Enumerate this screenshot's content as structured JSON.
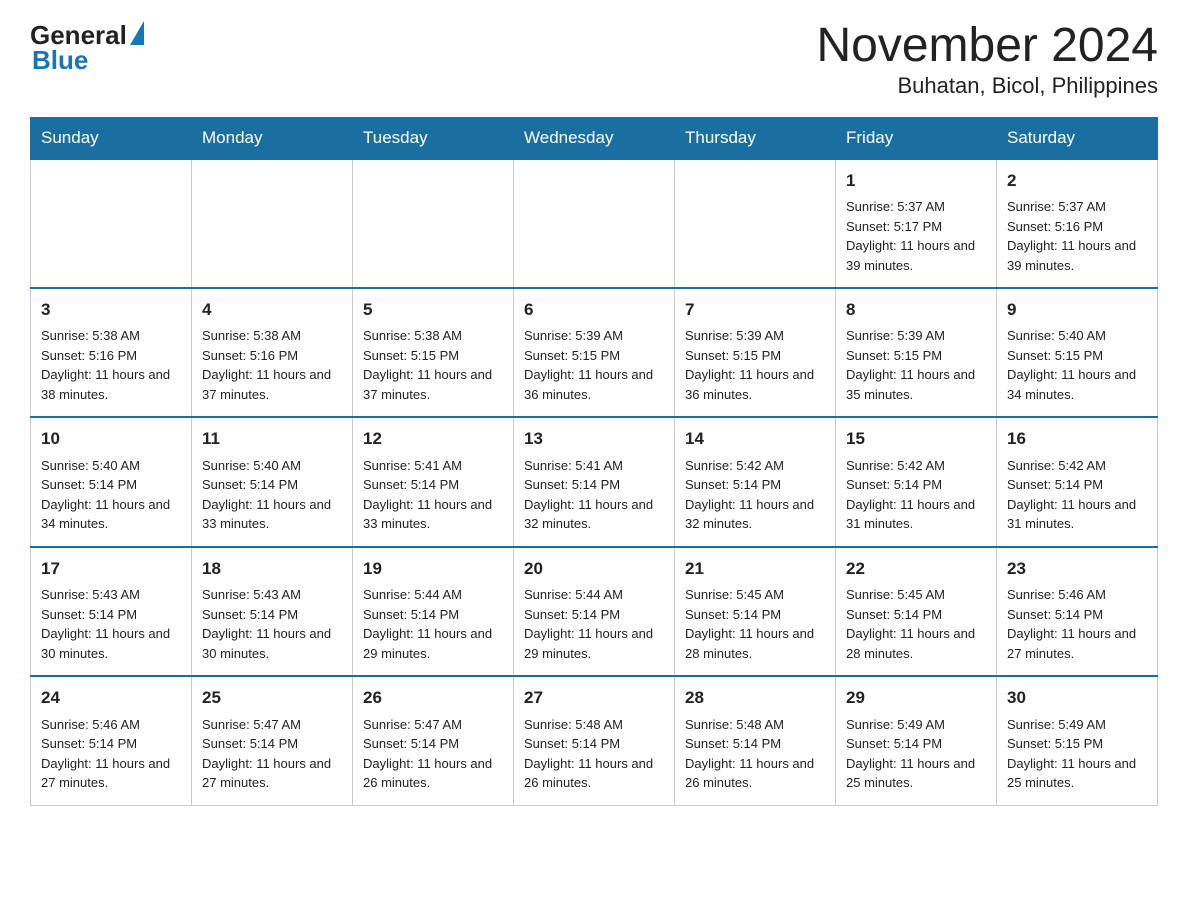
{
  "header": {
    "logo_general": "General",
    "logo_blue": "Blue",
    "title": "November 2024",
    "subtitle": "Buhatan, Bicol, Philippines"
  },
  "days_of_week": [
    "Sunday",
    "Monday",
    "Tuesday",
    "Wednesday",
    "Thursday",
    "Friday",
    "Saturday"
  ],
  "weeks": [
    [
      {
        "day": "",
        "info": ""
      },
      {
        "day": "",
        "info": ""
      },
      {
        "day": "",
        "info": ""
      },
      {
        "day": "",
        "info": ""
      },
      {
        "day": "",
        "info": ""
      },
      {
        "day": "1",
        "info": "Sunrise: 5:37 AM\nSunset: 5:17 PM\nDaylight: 11 hours and 39 minutes."
      },
      {
        "day": "2",
        "info": "Sunrise: 5:37 AM\nSunset: 5:16 PM\nDaylight: 11 hours and 39 minutes."
      }
    ],
    [
      {
        "day": "3",
        "info": "Sunrise: 5:38 AM\nSunset: 5:16 PM\nDaylight: 11 hours and 38 minutes."
      },
      {
        "day": "4",
        "info": "Sunrise: 5:38 AM\nSunset: 5:16 PM\nDaylight: 11 hours and 37 minutes."
      },
      {
        "day": "5",
        "info": "Sunrise: 5:38 AM\nSunset: 5:15 PM\nDaylight: 11 hours and 37 minutes."
      },
      {
        "day": "6",
        "info": "Sunrise: 5:39 AM\nSunset: 5:15 PM\nDaylight: 11 hours and 36 minutes."
      },
      {
        "day": "7",
        "info": "Sunrise: 5:39 AM\nSunset: 5:15 PM\nDaylight: 11 hours and 36 minutes."
      },
      {
        "day": "8",
        "info": "Sunrise: 5:39 AM\nSunset: 5:15 PM\nDaylight: 11 hours and 35 minutes."
      },
      {
        "day": "9",
        "info": "Sunrise: 5:40 AM\nSunset: 5:15 PM\nDaylight: 11 hours and 34 minutes."
      }
    ],
    [
      {
        "day": "10",
        "info": "Sunrise: 5:40 AM\nSunset: 5:14 PM\nDaylight: 11 hours and 34 minutes."
      },
      {
        "day": "11",
        "info": "Sunrise: 5:40 AM\nSunset: 5:14 PM\nDaylight: 11 hours and 33 minutes."
      },
      {
        "day": "12",
        "info": "Sunrise: 5:41 AM\nSunset: 5:14 PM\nDaylight: 11 hours and 33 minutes."
      },
      {
        "day": "13",
        "info": "Sunrise: 5:41 AM\nSunset: 5:14 PM\nDaylight: 11 hours and 32 minutes."
      },
      {
        "day": "14",
        "info": "Sunrise: 5:42 AM\nSunset: 5:14 PM\nDaylight: 11 hours and 32 minutes."
      },
      {
        "day": "15",
        "info": "Sunrise: 5:42 AM\nSunset: 5:14 PM\nDaylight: 11 hours and 31 minutes."
      },
      {
        "day": "16",
        "info": "Sunrise: 5:42 AM\nSunset: 5:14 PM\nDaylight: 11 hours and 31 minutes."
      }
    ],
    [
      {
        "day": "17",
        "info": "Sunrise: 5:43 AM\nSunset: 5:14 PM\nDaylight: 11 hours and 30 minutes."
      },
      {
        "day": "18",
        "info": "Sunrise: 5:43 AM\nSunset: 5:14 PM\nDaylight: 11 hours and 30 minutes."
      },
      {
        "day": "19",
        "info": "Sunrise: 5:44 AM\nSunset: 5:14 PM\nDaylight: 11 hours and 29 minutes."
      },
      {
        "day": "20",
        "info": "Sunrise: 5:44 AM\nSunset: 5:14 PM\nDaylight: 11 hours and 29 minutes."
      },
      {
        "day": "21",
        "info": "Sunrise: 5:45 AM\nSunset: 5:14 PM\nDaylight: 11 hours and 28 minutes."
      },
      {
        "day": "22",
        "info": "Sunrise: 5:45 AM\nSunset: 5:14 PM\nDaylight: 11 hours and 28 minutes."
      },
      {
        "day": "23",
        "info": "Sunrise: 5:46 AM\nSunset: 5:14 PM\nDaylight: 11 hours and 27 minutes."
      }
    ],
    [
      {
        "day": "24",
        "info": "Sunrise: 5:46 AM\nSunset: 5:14 PM\nDaylight: 11 hours and 27 minutes."
      },
      {
        "day": "25",
        "info": "Sunrise: 5:47 AM\nSunset: 5:14 PM\nDaylight: 11 hours and 27 minutes."
      },
      {
        "day": "26",
        "info": "Sunrise: 5:47 AM\nSunset: 5:14 PM\nDaylight: 11 hours and 26 minutes."
      },
      {
        "day": "27",
        "info": "Sunrise: 5:48 AM\nSunset: 5:14 PM\nDaylight: 11 hours and 26 minutes."
      },
      {
        "day": "28",
        "info": "Sunrise: 5:48 AM\nSunset: 5:14 PM\nDaylight: 11 hours and 26 minutes."
      },
      {
        "day": "29",
        "info": "Sunrise: 5:49 AM\nSunset: 5:14 PM\nDaylight: 11 hours and 25 minutes."
      },
      {
        "day": "30",
        "info": "Sunrise: 5:49 AM\nSunset: 5:15 PM\nDaylight: 11 hours and 25 minutes."
      }
    ]
  ]
}
